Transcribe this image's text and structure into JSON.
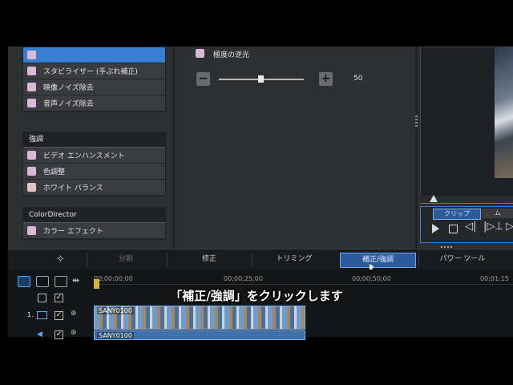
{
  "effects_group_top": {
    "items": [
      {
        "label": "",
        "selected": true
      },
      {
        "label": "スタビライザー (手ぶれ補正)",
        "selected": false
      },
      {
        "label": "映像ノイズ除去",
        "selected": false
      },
      {
        "label": "音声ノイズ除去",
        "selected": false
      }
    ]
  },
  "effects_group_enhance": {
    "header": "強調",
    "items": [
      {
        "label": "ビデオ エンハンスメント"
      },
      {
        "label": "色調整"
      },
      {
        "label": "ホワイト バランス"
      }
    ]
  },
  "effects_group_colordirector": {
    "header": "ColorDirector",
    "items": [
      {
        "label": "カラー エフェクト"
      }
    ]
  },
  "settings": {
    "option_label": "極度の逆光",
    "slider_value": "50",
    "slider_fraction": 0.5,
    "minus_label": "−",
    "plus_label": "+"
  },
  "preview": {
    "tab_clip": "クリップ",
    "tab_other": "ム"
  },
  "toolbar": {
    "tabs": [
      {
        "label": "分割",
        "active": false
      },
      {
        "label": "修正",
        "active": false
      },
      {
        "label": "トリミング",
        "active": false
      },
      {
        "label": "補正/強調",
        "active": true
      },
      {
        "label": "パワー ツール",
        "active": false
      }
    ]
  },
  "timeline": {
    "timecodes": [
      "00;00;00;00",
      "00;00;25;00",
      "00;00;50;00",
      "00;01;15"
    ],
    "track_number": "1.",
    "clip_name": "SANY0100",
    "clip_name_2": "SANY0100"
  },
  "caption": "「補正/強調」をクリックします",
  "colors": {
    "accent": "#3a7ed2",
    "checkbox_swatch": "#d9b8d9",
    "caption_text": "#ffffff"
  }
}
